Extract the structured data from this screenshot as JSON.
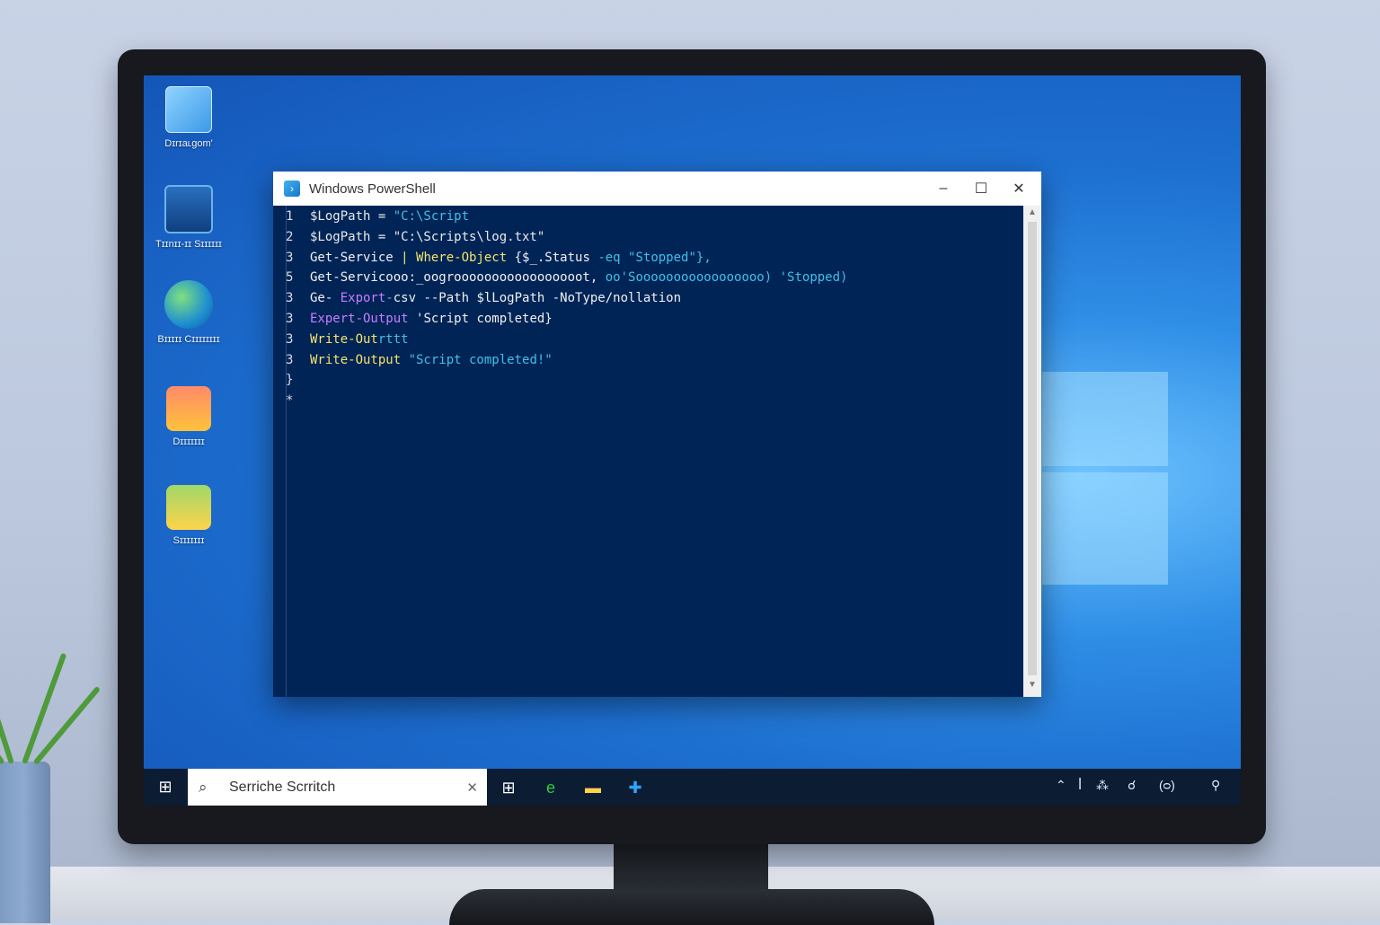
{
  "desktop": {
    "icons": [
      {
        "label": "Dɪrɪaʟgom'"
      },
      {
        "label": "Tɪɪnɪɪ-ɪɪ Sɪɪɪɪɪɪ"
      },
      {
        "label": "Bɪɪɪɪɪ Cɪɪɪɪɪɪɪɪ"
      },
      {
        "label": "Dɪɪɪɪɪɪɪ"
      },
      {
        "label": "Sɪɪɪɪɪɪɪ"
      }
    ]
  },
  "window": {
    "title": "Windows PowerShell",
    "minimize": "–",
    "maximize": "☐",
    "close": "✕",
    "lines": [
      {
        "num": "1",
        "parts": [
          [
            "c-var",
            "$LogPath = "
          ],
          [
            "c-str",
            "\"C:\\Script"
          ]
        ]
      },
      {
        "num": "2",
        "parts": [
          [
            "c-var",
            "$LogPath = "
          ],
          [
            "c-var",
            "\"C:\\Scripts\\log.txt\""
          ]
        ]
      },
      {
        "num": "3",
        "parts": [
          [
            "c-cmd",
            "Get-Service "
          ],
          [
            "c-kw",
            "| Where-Object "
          ],
          [
            "c-cmd",
            "{$_.Status "
          ],
          [
            "c-str",
            "-eq \"Stopped\"},"
          ]
        ]
      },
      {
        "num": "5",
        "parts": [
          [
            "c-cmd",
            "Get-Servicooo:_oogrooooooooooooooooot, "
          ],
          [
            "c-str",
            "oo'Sooooooooooooooooo) "
          ],
          [
            "c-str",
            "'Stopped)"
          ]
        ]
      },
      {
        "num": "3",
        "parts": [
          [
            "c-cmd",
            "Ge- "
          ],
          [
            "c-pur",
            "Export-"
          ],
          [
            "c-cmd",
            "csv --Path $lLogPath -NoType/nollation"
          ]
        ]
      },
      {
        "num": "3",
        "parts": [
          [
            "c-pur",
            "Expert-Output "
          ],
          [
            "c-cmd",
            "'Script completed}"
          ]
        ]
      },
      {
        "num": "3",
        "parts": [
          [
            "c-kw",
            "Write-Out"
          ],
          [
            "c-str",
            "rttt"
          ]
        ]
      },
      {
        "num": "3",
        "parts": [
          [
            "c-kw",
            "Write-Output "
          ],
          [
            "c-str",
            "\"Script completed!\""
          ]
        ]
      },
      {
        "num": "}",
        "parts": []
      },
      {
        "num": "*",
        "parts": []
      }
    ]
  },
  "taskbar": {
    "start_icon": "⊞",
    "search_placeholder": "Serriche Scrritch",
    "search_icon": "⌕",
    "clear_icon": "✕",
    "apps": [
      {
        "name": "taskview-icon",
        "glyph": "⊞",
        "color": "#ffffff"
      },
      {
        "name": "edge-icon",
        "glyph": "e",
        "color": "#2ecc40"
      },
      {
        "name": "file-explorer-icon",
        "glyph": "▬",
        "color": "#ffd24a"
      },
      {
        "name": "store-icon",
        "glyph": "✚",
        "color": "#2fa3ff"
      }
    ],
    "tray": [
      "⌃",
      "ꟾ",
      "⁂",
      "☌",
      "(ᴑ)",
      "⚲"
    ]
  }
}
